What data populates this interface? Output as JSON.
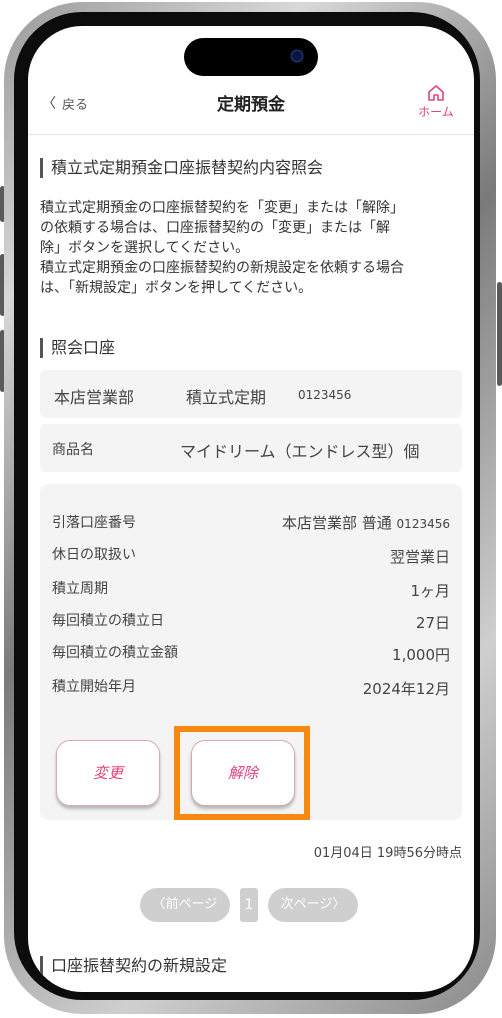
{
  "header": {
    "back_label": "戻る",
    "title": "定期預金",
    "home_label": "ホーム"
  },
  "section1": {
    "title": "積立式定期預金口座振替契約内容照会",
    "lines": [
      "積立式定期預金の口座振替契約を「変更」または「解除」",
      "の依頼する場合は、口座振替契約の「変更」または「解",
      "除」ボタンを選択してください。",
      "積立式定期預金の口座振替契約の新規設定を依頼する場合",
      "は、「新規設定」ボタンを押してください。"
    ]
  },
  "section2": {
    "title": "照会口座",
    "branch": "本店営業部",
    "account_type": "積立式定期",
    "account_number": "0123456",
    "product_label": "商品名",
    "product_name": "マイドリーム（エンドレス型）個"
  },
  "details": [
    {
      "label": "引落口座番号",
      "value": "本店営業部 普通",
      "sub": "0123456"
    },
    {
      "label": "休日の取扱い",
      "value": "翌営業日",
      "sub": ""
    },
    {
      "label": "積立周期",
      "value": "1ヶ月",
      "sub": ""
    },
    {
      "label": "毎回積立の積立日",
      "value": "27日",
      "sub": ""
    },
    {
      "label": "毎回積立の積立金額",
      "value": "1,000円",
      "sub": ""
    },
    {
      "label": "積立開始年月",
      "value": "2024年12月",
      "sub": ""
    }
  ],
  "buttons": {
    "change": "変更",
    "cancel": "解除"
  },
  "timestamp": "01月04日 19時56分時点",
  "pager": {
    "prev": "〈前ページ",
    "current": "1",
    "next": "次ページ〉"
  },
  "section3": {
    "title": "口座振替契約の新規設定"
  },
  "colors": {
    "accent": "#e0457b",
    "highlight": "#f7890f",
    "panel": "#f4f4f4"
  }
}
